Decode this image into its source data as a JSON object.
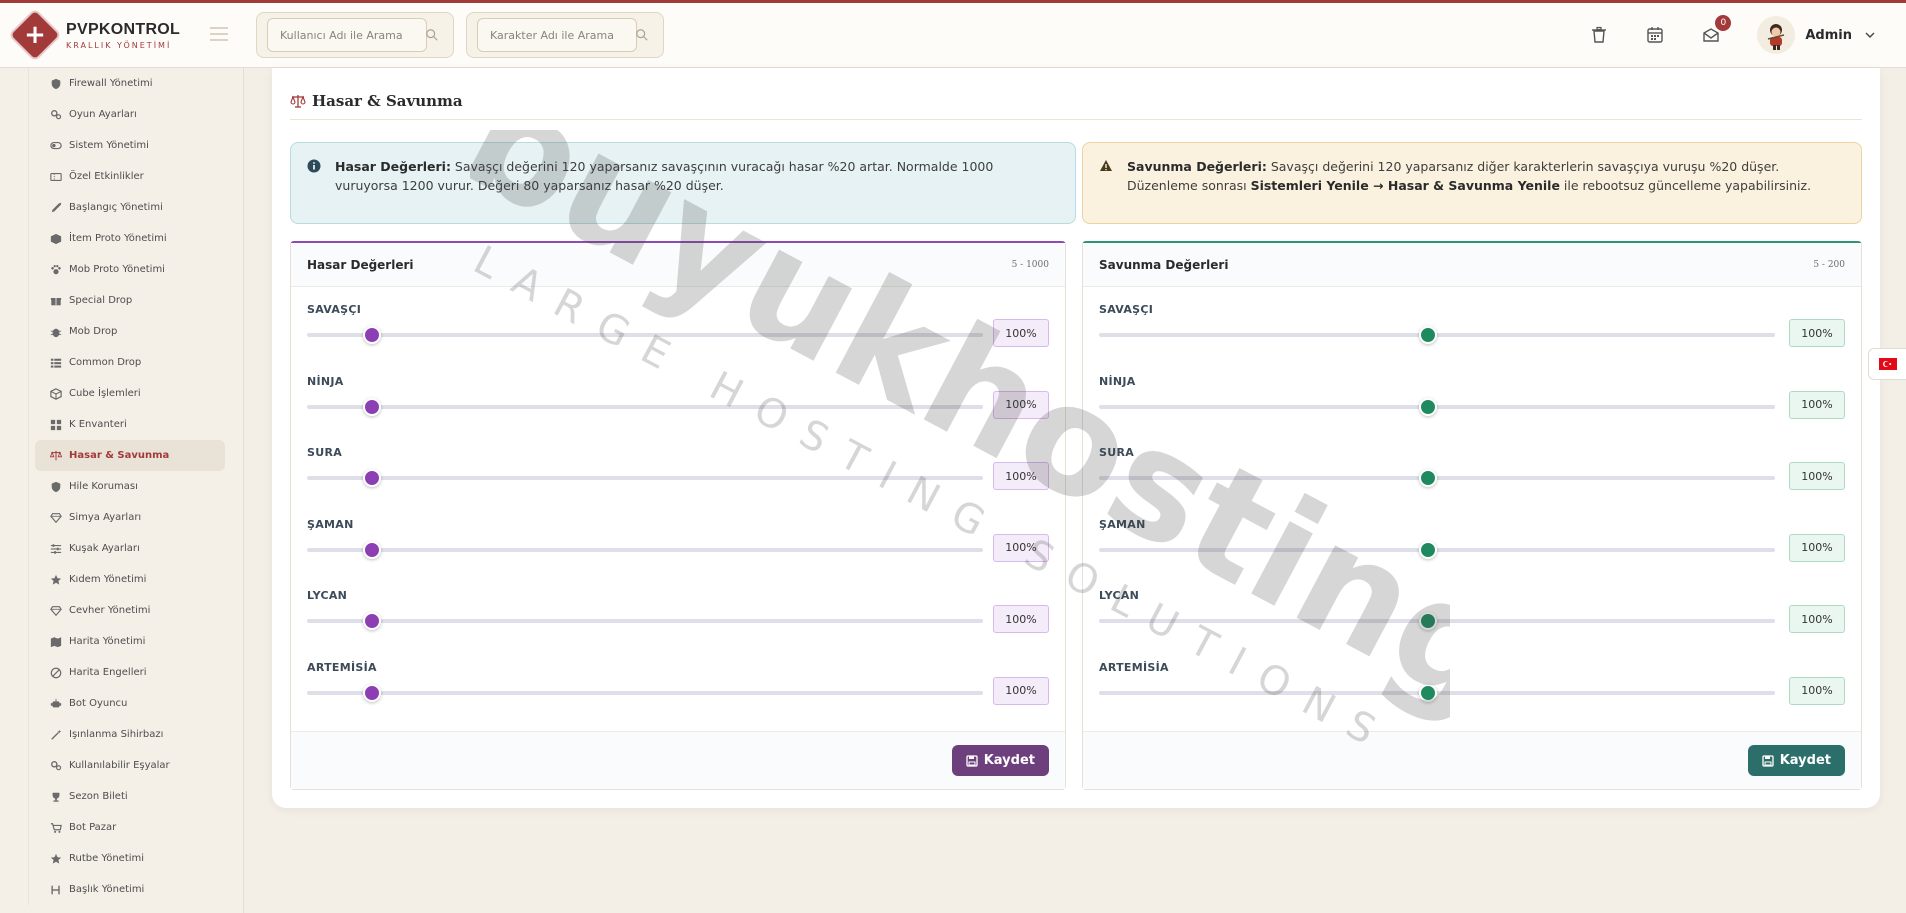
{
  "brand": {
    "title": "PVPKONTROL",
    "subtitle": "KRALLIK YÖNETİMİ"
  },
  "search": {
    "user_placeholder": "Kullanıcı Adı ile Arama",
    "character_placeholder": "Karakter Adı ile Arama"
  },
  "header": {
    "notification_count": "0",
    "admin_name": "Admin"
  },
  "sidebar": {
    "items": [
      {
        "label": "Firewall Yönetimi",
        "icon": "shield-icon"
      },
      {
        "label": "Oyun Ayarları",
        "icon": "gears-icon"
      },
      {
        "label": "Sistem Yönetimi",
        "icon": "toggle-icon"
      },
      {
        "label": "Özel Etkinlikler",
        "icon": "ticket-icon"
      },
      {
        "label": "Başlangıç Yönetimi",
        "icon": "rocket-icon"
      },
      {
        "label": "İtem Proto Yönetimi",
        "icon": "box-icon"
      },
      {
        "label": "Mob Proto Yönetimi",
        "icon": "paw-icon"
      },
      {
        "label": "Special Drop",
        "icon": "gift-icon"
      },
      {
        "label": "Mob Drop",
        "icon": "bug-icon"
      },
      {
        "label": "Common Drop",
        "icon": "list-icon"
      },
      {
        "label": "Cube İşlemleri",
        "icon": "cube-icon"
      },
      {
        "label": "K Envanteri",
        "icon": "grid-icon"
      },
      {
        "label": "Hasar & Savunma",
        "icon": "scale-icon",
        "active": true
      },
      {
        "label": "Hile Koruması",
        "icon": "shield-icon"
      },
      {
        "label": "Simya Ayarları",
        "icon": "gem-icon"
      },
      {
        "label": "Kuşak Ayarları",
        "icon": "sliders-icon"
      },
      {
        "label": "Kıdem Yönetimi",
        "icon": "star-icon"
      },
      {
        "label": "Cevher Yönetimi",
        "icon": "gem-icon"
      },
      {
        "label": "Harita Yönetimi",
        "icon": "map-icon"
      },
      {
        "label": "Harita Engelleri",
        "icon": "ban-icon"
      },
      {
        "label": "Bot Oyuncu",
        "icon": "robot-icon"
      },
      {
        "label": "Işınlanma Sihirbazı",
        "icon": "wand-icon"
      },
      {
        "label": "Kullanılabilir Eşyalar",
        "icon": "gears-icon"
      },
      {
        "label": "Sezon Bileti",
        "icon": "trophy-icon"
      },
      {
        "label": "Bot Pazar",
        "icon": "cart-icon"
      },
      {
        "label": "Rutbe Yönetimi",
        "icon": "star-icon"
      },
      {
        "label": "Başlık Yönetimi",
        "icon": "heading-icon"
      }
    ]
  },
  "page": {
    "title": "Hasar & Savunma"
  },
  "alerts": {
    "info": {
      "bold": "Hasar Değerleri:",
      "text": " Savaşçı değerini 120 yaparsanız savaşçının vuracağı hasar %20 artar. Normalde 1000 vuruyorsa 1200 vurur. Değeri 80 yaparsanız hasar %20 düşer."
    },
    "warning": {
      "bold": "Savunma Değerleri:",
      "text": " Savaşçı değerini 120 yaparsanız diğer karakterlerin savaşçıya vuruşu %20 düşer. Düzenleme sonrası ",
      "path": "Sistemleri Yenile → Hasar & Savunma Yenile",
      "tail": " ile rebootsuz güncelleme yapabilirsiniz."
    }
  },
  "damage_panel": {
    "title": "Hasar Değerleri",
    "range": "5 - 1000",
    "min": 5,
    "max": 1000,
    "save_label": "Kaydet",
    "rows": [
      {
        "label": "SAVAŞÇI",
        "value": 100,
        "display": "100%"
      },
      {
        "label": "NİNJA",
        "value": 100,
        "display": "100%"
      },
      {
        "label": "SURA",
        "value": 100,
        "display": "100%"
      },
      {
        "label": "ŞAMAN",
        "value": 100,
        "display": "100%"
      },
      {
        "label": "LYCAN",
        "value": 100,
        "display": "100%"
      },
      {
        "label": "ARTEMİSİA",
        "value": 100,
        "display": "100%"
      }
    ]
  },
  "defense_panel": {
    "title": "Savunma Değerleri",
    "range": "5 - 200",
    "min": 5,
    "max": 200,
    "save_label": "Kaydet",
    "rows": [
      {
        "label": "SAVAŞÇI",
        "value": 100,
        "display": "100%"
      },
      {
        "label": "NİNJA",
        "value": 100,
        "display": "100%"
      },
      {
        "label": "SURA",
        "value": 100,
        "display": "100%"
      },
      {
        "label": "ŞAMAN",
        "value": 100,
        "display": "100%"
      },
      {
        "label": "LYCAN",
        "value": 100,
        "display": "100%"
      },
      {
        "label": "ARTEMİSİA",
        "value": 100,
        "display": "100%"
      }
    ]
  },
  "watermark": {
    "main": "buyukhosting",
    "sub": "LARGE HOSTING SOLUTIONS"
  },
  "colors": {
    "brand": "#a33a3a",
    "damage_accent": "#8b3fb3",
    "defense_accent": "#1f8a5f",
    "damage_button": "#6e3f7d",
    "defense_button": "#2c6f6a"
  }
}
